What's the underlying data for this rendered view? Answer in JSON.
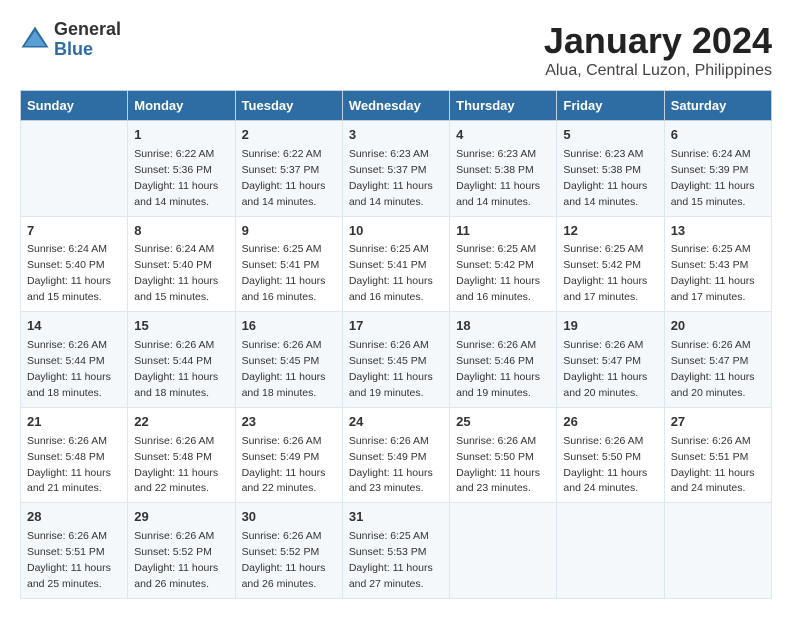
{
  "header": {
    "logo_general": "General",
    "logo_blue": "Blue",
    "main_title": "January 2024",
    "subtitle": "Alua, Central Luzon, Philippines"
  },
  "days_of_week": [
    "Sunday",
    "Monday",
    "Tuesday",
    "Wednesday",
    "Thursday",
    "Friday",
    "Saturday"
  ],
  "weeks": [
    [
      {
        "day": "",
        "sunrise": "",
        "sunset": "",
        "daylight": ""
      },
      {
        "day": "1",
        "sunrise": "Sunrise: 6:22 AM",
        "sunset": "Sunset: 5:36 PM",
        "daylight": "Daylight: 11 hours and 14 minutes."
      },
      {
        "day": "2",
        "sunrise": "Sunrise: 6:22 AM",
        "sunset": "Sunset: 5:37 PM",
        "daylight": "Daylight: 11 hours and 14 minutes."
      },
      {
        "day": "3",
        "sunrise": "Sunrise: 6:23 AM",
        "sunset": "Sunset: 5:37 PM",
        "daylight": "Daylight: 11 hours and 14 minutes."
      },
      {
        "day": "4",
        "sunrise": "Sunrise: 6:23 AM",
        "sunset": "Sunset: 5:38 PM",
        "daylight": "Daylight: 11 hours and 14 minutes."
      },
      {
        "day": "5",
        "sunrise": "Sunrise: 6:23 AM",
        "sunset": "Sunset: 5:38 PM",
        "daylight": "Daylight: 11 hours and 14 minutes."
      },
      {
        "day": "6",
        "sunrise": "Sunrise: 6:24 AM",
        "sunset": "Sunset: 5:39 PM",
        "daylight": "Daylight: 11 hours and 15 minutes."
      }
    ],
    [
      {
        "day": "7",
        "sunrise": "Sunrise: 6:24 AM",
        "sunset": "Sunset: 5:40 PM",
        "daylight": "Daylight: 11 hours and 15 minutes."
      },
      {
        "day": "8",
        "sunrise": "Sunrise: 6:24 AM",
        "sunset": "Sunset: 5:40 PM",
        "daylight": "Daylight: 11 hours and 15 minutes."
      },
      {
        "day": "9",
        "sunrise": "Sunrise: 6:25 AM",
        "sunset": "Sunset: 5:41 PM",
        "daylight": "Daylight: 11 hours and 16 minutes."
      },
      {
        "day": "10",
        "sunrise": "Sunrise: 6:25 AM",
        "sunset": "Sunset: 5:41 PM",
        "daylight": "Daylight: 11 hours and 16 minutes."
      },
      {
        "day": "11",
        "sunrise": "Sunrise: 6:25 AM",
        "sunset": "Sunset: 5:42 PM",
        "daylight": "Daylight: 11 hours and 16 minutes."
      },
      {
        "day": "12",
        "sunrise": "Sunrise: 6:25 AM",
        "sunset": "Sunset: 5:42 PM",
        "daylight": "Daylight: 11 hours and 17 minutes."
      },
      {
        "day": "13",
        "sunrise": "Sunrise: 6:25 AM",
        "sunset": "Sunset: 5:43 PM",
        "daylight": "Daylight: 11 hours and 17 minutes."
      }
    ],
    [
      {
        "day": "14",
        "sunrise": "Sunrise: 6:26 AM",
        "sunset": "Sunset: 5:44 PM",
        "daylight": "Daylight: 11 hours and 18 minutes."
      },
      {
        "day": "15",
        "sunrise": "Sunrise: 6:26 AM",
        "sunset": "Sunset: 5:44 PM",
        "daylight": "Daylight: 11 hours and 18 minutes."
      },
      {
        "day": "16",
        "sunrise": "Sunrise: 6:26 AM",
        "sunset": "Sunset: 5:45 PM",
        "daylight": "Daylight: 11 hours and 18 minutes."
      },
      {
        "day": "17",
        "sunrise": "Sunrise: 6:26 AM",
        "sunset": "Sunset: 5:45 PM",
        "daylight": "Daylight: 11 hours and 19 minutes."
      },
      {
        "day": "18",
        "sunrise": "Sunrise: 6:26 AM",
        "sunset": "Sunset: 5:46 PM",
        "daylight": "Daylight: 11 hours and 19 minutes."
      },
      {
        "day": "19",
        "sunrise": "Sunrise: 6:26 AM",
        "sunset": "Sunset: 5:47 PM",
        "daylight": "Daylight: 11 hours and 20 minutes."
      },
      {
        "day": "20",
        "sunrise": "Sunrise: 6:26 AM",
        "sunset": "Sunset: 5:47 PM",
        "daylight": "Daylight: 11 hours and 20 minutes."
      }
    ],
    [
      {
        "day": "21",
        "sunrise": "Sunrise: 6:26 AM",
        "sunset": "Sunset: 5:48 PM",
        "daylight": "Daylight: 11 hours and 21 minutes."
      },
      {
        "day": "22",
        "sunrise": "Sunrise: 6:26 AM",
        "sunset": "Sunset: 5:48 PM",
        "daylight": "Daylight: 11 hours and 22 minutes."
      },
      {
        "day": "23",
        "sunrise": "Sunrise: 6:26 AM",
        "sunset": "Sunset: 5:49 PM",
        "daylight": "Daylight: 11 hours and 22 minutes."
      },
      {
        "day": "24",
        "sunrise": "Sunrise: 6:26 AM",
        "sunset": "Sunset: 5:49 PM",
        "daylight": "Daylight: 11 hours and 23 minutes."
      },
      {
        "day": "25",
        "sunrise": "Sunrise: 6:26 AM",
        "sunset": "Sunset: 5:50 PM",
        "daylight": "Daylight: 11 hours and 23 minutes."
      },
      {
        "day": "26",
        "sunrise": "Sunrise: 6:26 AM",
        "sunset": "Sunset: 5:50 PM",
        "daylight": "Daylight: 11 hours and 24 minutes."
      },
      {
        "day": "27",
        "sunrise": "Sunrise: 6:26 AM",
        "sunset": "Sunset: 5:51 PM",
        "daylight": "Daylight: 11 hours and 24 minutes."
      }
    ],
    [
      {
        "day": "28",
        "sunrise": "Sunrise: 6:26 AM",
        "sunset": "Sunset: 5:51 PM",
        "daylight": "Daylight: 11 hours and 25 minutes."
      },
      {
        "day": "29",
        "sunrise": "Sunrise: 6:26 AM",
        "sunset": "Sunset: 5:52 PM",
        "daylight": "Daylight: 11 hours and 26 minutes."
      },
      {
        "day": "30",
        "sunrise": "Sunrise: 6:26 AM",
        "sunset": "Sunset: 5:52 PM",
        "daylight": "Daylight: 11 hours and 26 minutes."
      },
      {
        "day": "31",
        "sunrise": "Sunrise: 6:25 AM",
        "sunset": "Sunset: 5:53 PM",
        "daylight": "Daylight: 11 hours and 27 minutes."
      },
      {
        "day": "",
        "sunrise": "",
        "sunset": "",
        "daylight": ""
      },
      {
        "day": "",
        "sunrise": "",
        "sunset": "",
        "daylight": ""
      },
      {
        "day": "",
        "sunrise": "",
        "sunset": "",
        "daylight": ""
      }
    ]
  ]
}
